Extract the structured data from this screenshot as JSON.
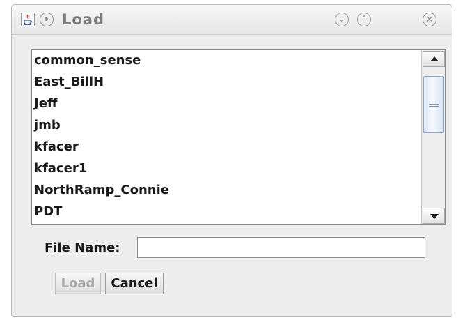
{
  "window": {
    "title": "Load"
  },
  "file_list": {
    "items": [
      "common_sense",
      "East_BillH",
      "Jeff",
      "jmb",
      "kfacer",
      "kfacer1",
      "NorthRamp_Connie",
      "PDT"
    ]
  },
  "file_name": {
    "label": "File Name:",
    "value": ""
  },
  "buttons": {
    "load": "Load",
    "cancel": "Cancel"
  },
  "colors": {
    "window_bg": "#ededed",
    "scroll_thumb": "#dbe6f3",
    "disabled_text": "#a9a9a9"
  }
}
